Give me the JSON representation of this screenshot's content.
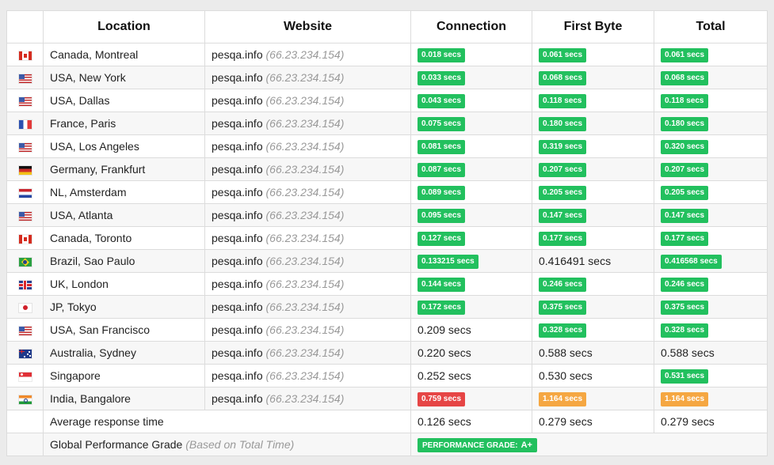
{
  "headers": {
    "flag": "",
    "location": "Location",
    "website": "Website",
    "connection": "Connection",
    "first_byte": "First Byte",
    "total": "Total"
  },
  "rows": [
    {
      "flag": "canada-flag-icon",
      "fc": "ca",
      "location": "Canada, Montreal",
      "site": "pesqa.info",
      "ip": "(66.23.234.154)",
      "connection": "0.018 secs",
      "cs": "g",
      "first_byte": "0.061 secs",
      "fs": "g",
      "total": "0.061 secs",
      "ts": "g"
    },
    {
      "flag": "usa-flag-icon",
      "fc": "us",
      "location": "USA, New York",
      "site": "pesqa.info",
      "ip": "(66.23.234.154)",
      "connection": "0.033 secs",
      "cs": "g",
      "first_byte": "0.068 secs",
      "fs": "g",
      "total": "0.068 secs",
      "ts": "g"
    },
    {
      "flag": "usa-flag-icon",
      "fc": "us",
      "location": "USA, Dallas",
      "site": "pesqa.info",
      "ip": "(66.23.234.154)",
      "connection": "0.043 secs",
      "cs": "g",
      "first_byte": "0.118 secs",
      "fs": "g",
      "total": "0.118 secs",
      "ts": "g"
    },
    {
      "flag": "france-flag-icon",
      "fc": "fr",
      "location": "France, Paris",
      "site": "pesqa.info",
      "ip": "(66.23.234.154)",
      "connection": "0.075 secs",
      "cs": "g",
      "first_byte": "0.180 secs",
      "fs": "g",
      "total": "0.180 secs",
      "ts": "g"
    },
    {
      "flag": "usa-flag-icon",
      "fc": "us",
      "location": "USA, Los Angeles",
      "site": "pesqa.info",
      "ip": "(66.23.234.154)",
      "connection": "0.081 secs",
      "cs": "g",
      "first_byte": "0.319 secs",
      "fs": "g",
      "total": "0.320 secs",
      "ts": "g"
    },
    {
      "flag": "germany-flag-icon",
      "fc": "de",
      "location": "Germany, Frankfurt",
      "site": "pesqa.info",
      "ip": "(66.23.234.154)",
      "connection": "0.087 secs",
      "cs": "g",
      "first_byte": "0.207 secs",
      "fs": "g",
      "total": "0.207 secs",
      "ts": "g"
    },
    {
      "flag": "netherlands-flag-icon",
      "fc": "nl",
      "location": "NL, Amsterdam",
      "site": "pesqa.info",
      "ip": "(66.23.234.154)",
      "connection": "0.089 secs",
      "cs": "g",
      "first_byte": "0.205 secs",
      "fs": "g",
      "total": "0.205 secs",
      "ts": "g"
    },
    {
      "flag": "usa-flag-icon",
      "fc": "us",
      "location": "USA, Atlanta",
      "site": "pesqa.info",
      "ip": "(66.23.234.154)",
      "connection": "0.095 secs",
      "cs": "g",
      "first_byte": "0.147 secs",
      "fs": "g",
      "total": "0.147 secs",
      "ts": "g"
    },
    {
      "flag": "canada-flag-icon",
      "fc": "ca",
      "location": "Canada, Toronto",
      "site": "pesqa.info",
      "ip": "(66.23.234.154)",
      "connection": "0.127 secs",
      "cs": "g",
      "first_byte": "0.177 secs",
      "fs": "g",
      "total": "0.177 secs",
      "ts": "g"
    },
    {
      "flag": "brazil-flag-icon",
      "fc": "br",
      "location": "Brazil, Sao Paulo",
      "site": "pesqa.info",
      "ip": "(66.23.234.154)",
      "connection": "0.133215 secs",
      "cs": "g",
      "first_byte": "0.416491 secs",
      "fs": "",
      "total": "0.416568 secs",
      "ts": "g"
    },
    {
      "flag": "uk-flag-icon",
      "fc": "uk",
      "location": "UK, London",
      "site": "pesqa.info",
      "ip": "(66.23.234.154)",
      "connection": "0.144 secs",
      "cs": "g",
      "first_byte": "0.246 secs",
      "fs": "g",
      "total": "0.246 secs",
      "ts": "g"
    },
    {
      "flag": "japan-flag-icon",
      "fc": "jp",
      "location": "JP, Tokyo",
      "site": "pesqa.info",
      "ip": "(66.23.234.154)",
      "connection": "0.172 secs",
      "cs": "g",
      "first_byte": "0.375 secs",
      "fs": "g",
      "total": "0.375 secs",
      "ts": "g"
    },
    {
      "flag": "usa-flag-icon",
      "fc": "us",
      "location": "USA, San Francisco",
      "site": "pesqa.info",
      "ip": "(66.23.234.154)",
      "connection": "0.209 secs",
      "cs": "",
      "first_byte": "0.328 secs",
      "fs": "g",
      "total": "0.328 secs",
      "ts": "g"
    },
    {
      "flag": "australia-flag-icon",
      "fc": "au",
      "location": "Australia, Sydney",
      "site": "pesqa.info",
      "ip": "(66.23.234.154)",
      "connection": "0.220 secs",
      "cs": "",
      "first_byte": "0.588 secs",
      "fs": "",
      "total": "0.588 secs",
      "ts": ""
    },
    {
      "flag": "singapore-flag-icon",
      "fc": "sg",
      "location": "Singapore",
      "site": "pesqa.info",
      "ip": "(66.23.234.154)",
      "connection": "0.252 secs",
      "cs": "",
      "first_byte": "0.530 secs",
      "fs": "",
      "total": "0.531 secs",
      "ts": "g"
    },
    {
      "flag": "india-flag-icon",
      "fc": "in",
      "location": "India, Bangalore",
      "site": "pesqa.info",
      "ip": "(66.23.234.154)",
      "connection": "0.759 secs",
      "cs": "r",
      "first_byte": "1.164 secs",
      "fs": "o",
      "total": "1.164 secs",
      "ts": "o"
    }
  ],
  "average": {
    "label": "Average response time",
    "connection": "0.126 secs",
    "first_byte": "0.279 secs",
    "total": "0.279 secs"
  },
  "grade": {
    "label": "Global Performance Grade",
    "note": "(Based on Total Time)",
    "badge_text": "PERFORMANCE GRADE:",
    "grade": "A+"
  },
  "colors": {
    "green": "#22c05e",
    "red": "#e64545",
    "orange": "#f5a742",
    "ip_gray": "#999999"
  }
}
